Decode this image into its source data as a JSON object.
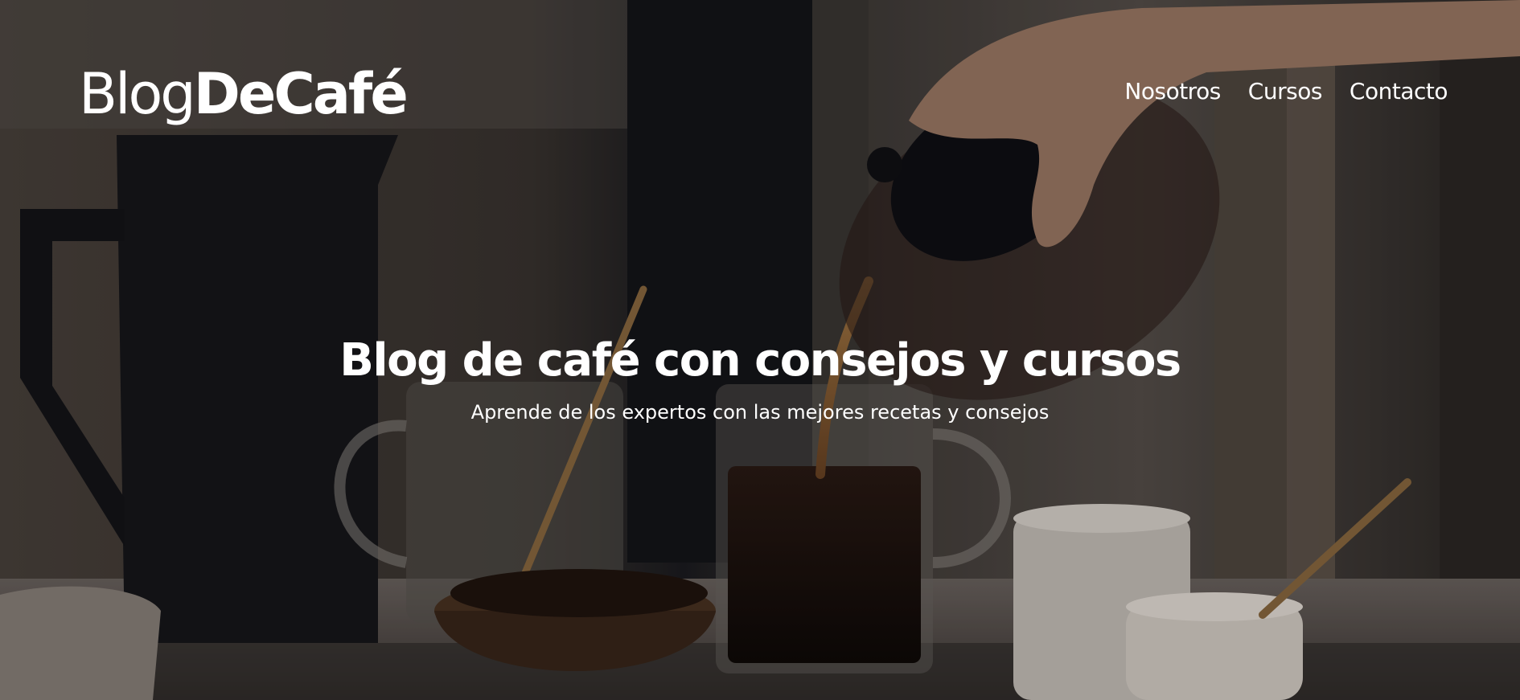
{
  "header": {
    "logo_light": "Blog",
    "logo_bold": "DeCafé",
    "nav": [
      {
        "label": "Nosotros"
      },
      {
        "label": "Cursos"
      },
      {
        "label": "Contacto"
      }
    ]
  },
  "hero": {
    "title": "Blog de café con consejos y cursos",
    "subtitle": "Aprende de los expertos con las mejores recetas y consejos"
  }
}
